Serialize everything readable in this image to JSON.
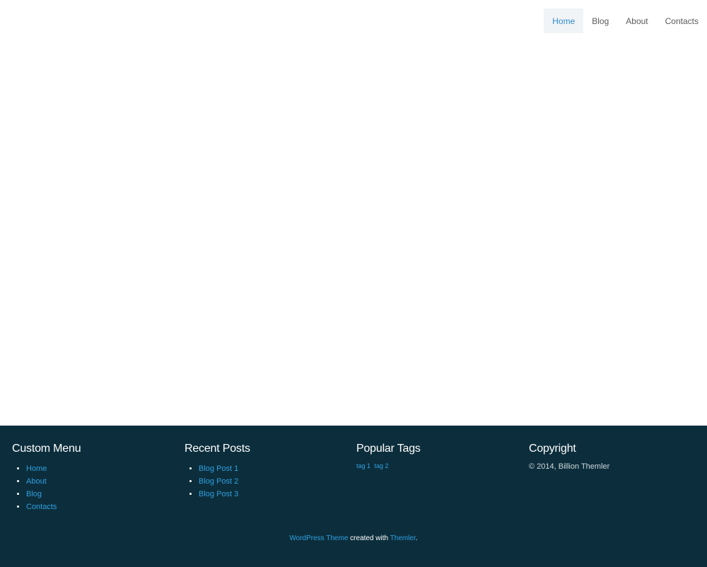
{
  "nav": {
    "items": [
      {
        "label": "Home",
        "active": true
      },
      {
        "label": "Blog",
        "active": false
      },
      {
        "label": "About",
        "active": false
      },
      {
        "label": "Contacts",
        "active": false
      }
    ]
  },
  "footer": {
    "custom_menu": {
      "title": "Custom Menu",
      "items": [
        "Home",
        "About",
        "Blog",
        "Contacts"
      ]
    },
    "recent_posts": {
      "title": "Recent Posts",
      "items": [
        "Blog Post 1",
        "Blog Post 2",
        "Blog Post 3"
      ]
    },
    "popular_tags": {
      "title": "Popular Tags",
      "tags": [
        "tag 1",
        "tag 2"
      ]
    },
    "copyright": {
      "title": "Copyright",
      "text": "© 2014, Billion Themler"
    },
    "credits": {
      "link1": "WordPress Theme",
      "middle": "created with",
      "link2": "Themler",
      "end": "."
    }
  },
  "colors": {
    "accent": "#2f8dcc",
    "footer_bg": "#0c2e3c",
    "nav_active_bg": "#f1f4f6"
  }
}
